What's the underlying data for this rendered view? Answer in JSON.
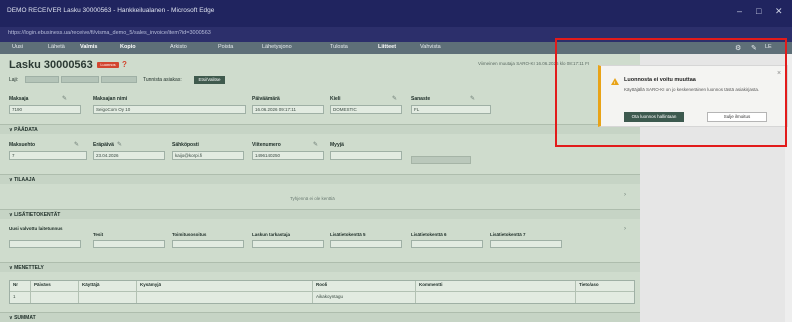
{
  "window": {
    "title": "DEMO RECEIVER Lasku 30000563 - Hankkeilualanen - Microsoft Edge",
    "url": "https://login.ebusiness.ua/receive/fi/visma_demo_5/sales_invoice/item?id=3000563",
    "controls": [
      "–",
      "□",
      "✕"
    ]
  },
  "toolbar": {
    "items": [
      "Uusi",
      "Lähetä",
      "Valmis",
      "Kopio",
      "Arkisto",
      "Poista",
      "Lähetysjono",
      "Tulosta",
      "Liitteet",
      "Vahvista"
    ],
    "right_icons": [
      "gear-icon",
      "pin-icon",
      "user-icon"
    ],
    "right_label": "LE"
  },
  "invoice": {
    "title": "Lasku 30000563",
    "status_badge": "Luonnos",
    "status_mark": "?",
    "last_saved": "Viimeinen muutaja SARO-KI 16.06.2026 klo 08:17:11 FI",
    "laji_label": "Laji:",
    "tunnista_label": "Tunnista asiakas:",
    "tunnista_button": "Etsi/Valitse"
  },
  "header_fields": [
    {
      "label": "Maksaja",
      "value": "7190"
    },
    {
      "label": "Maksajan nimi",
      "value": "SeigoCom Oy 10"
    },
    {
      "label": "Päiväämärä",
      "value": "16.06.2026 09:17:11"
    },
    {
      "label": "Kieli",
      "value": "DOMESTIC"
    },
    {
      "label": "Sanaste",
      "value": "FL"
    }
  ],
  "sections": {
    "paadata": "PÄÄDATA",
    "tilaaja": "TILAAJA",
    "lisatietokentat": "LISÄTIETOKENTÄT",
    "menettely": "MENETTELY",
    "summat": "SUMMAT"
  },
  "paadata_fields": [
    {
      "label": "Maksuehto",
      "value": "7"
    },
    {
      "label": "Eräpäivä",
      "value": "23.04.2026"
    },
    {
      "label": "Sähköposti",
      "value": "kaijo@korpi.fi"
    },
    {
      "label": "Viitenumero",
      "value": "1496140250"
    },
    {
      "label": "Myyjä",
      "value": ""
    }
  ],
  "tilaaja_empty": "Tyhjennä ei ole kenttiä",
  "lisatieto_fields": [
    "Uusi valvottu laitetunnus",
    "Tesit",
    "Toimitusosoitus",
    "Laskun tarkastaja",
    "Lisätietokenttä 5",
    "Lisätietokenttä 6",
    "Lisätietokenttä 7"
  ],
  "events_table": {
    "headers": [
      "Nr",
      "Päivävs",
      "Käyttäjä",
      "Kysämyjä",
      "Rooli",
      "Kommentti",
      "Tieto/aso"
    ],
    "row": [
      "1",
      "",
      "",
      "",
      "Aikakoyntagu",
      "",
      ""
    ]
  },
  "toast": {
    "title": "Luonnosta ei voitu muuttaa",
    "body": "Käyttäjällä SARO-KI on jo keskeneräinen luonnos tästä asiakirjasta.",
    "primary_button": "Ota luonnos hallintaan",
    "secondary_button": "Sulje ilmoitus",
    "close": "×"
  },
  "colors": {
    "content_bg": "#cfdccd",
    "title_bar": "#20245f",
    "toolbar": "#5e6f78",
    "warning": "#e8a317",
    "highlight": "#e21b1b"
  }
}
